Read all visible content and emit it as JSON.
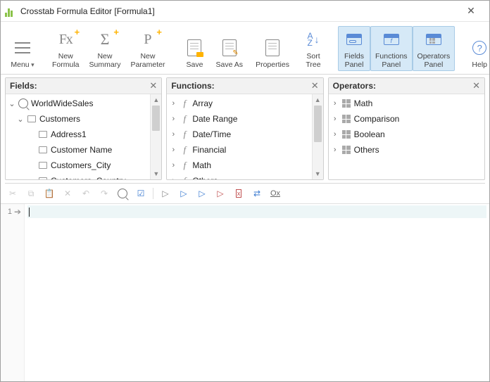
{
  "window": {
    "title": "Crosstab Formula Editor [Formula1]"
  },
  "ribbon": {
    "menu": "Menu",
    "new_formula": "New\nFormula",
    "new_summary": "New\nSummary",
    "new_parameter": "New\nParameter",
    "save": "Save",
    "save_as": "Save As",
    "properties": "Properties",
    "sort_tree": "Sort\nTree",
    "fields_panel": "Fields\nPanel",
    "functions_panel": "Functions\nPanel",
    "operators_panel": "Operators\nPanel",
    "help": "Help"
  },
  "panels": {
    "fields": {
      "title": "Fields:",
      "root": "WorldWideSales",
      "child": "Customers",
      "items": [
        "Address1",
        "Customer Name",
        "Customers_City",
        "Customers_Country"
      ]
    },
    "functions": {
      "title": "Functions:",
      "items": [
        "Array",
        "Date Range",
        "Date/Time",
        "Financial",
        "Math",
        "Others"
      ]
    },
    "operators": {
      "title": "Operators:",
      "items": [
        "Math",
        "Comparison",
        "Boolean",
        "Others"
      ]
    }
  },
  "editor": {
    "line_number": "1"
  },
  "toolbar2": {
    "ox": "Ox"
  }
}
